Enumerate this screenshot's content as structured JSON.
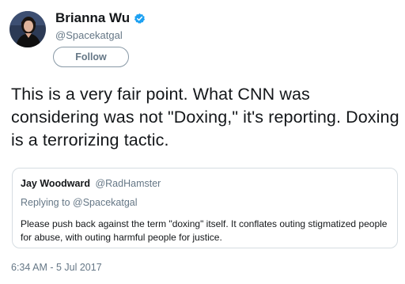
{
  "author": {
    "display_name": "Brianna Wu",
    "handle": "@Spacekatgal",
    "verified_icon": "verified-badge-icon",
    "follow_label": "Follow"
  },
  "tweet": {
    "text": "This is a very fair point. What CNN was considering was not \"Doxing,\" it's reporting. Doxing is a terrorizing tactic.",
    "timestamp": "6:34 AM - 5 Jul 2017"
  },
  "quoted_tweet": {
    "author_name": "Jay Woodward",
    "author_handle": "@RadHamster",
    "replying_prefix": "Replying to ",
    "replying_to": "@Spacekatgal",
    "text": "Please push back against the term \"doxing\" itself. It conflates outing stigmatized people for abuse, with outing harmful people for justice."
  },
  "colors": {
    "text": "#14171a",
    "secondary": "#657786",
    "verified": "#1da1f2",
    "border": "#d6dde2"
  }
}
